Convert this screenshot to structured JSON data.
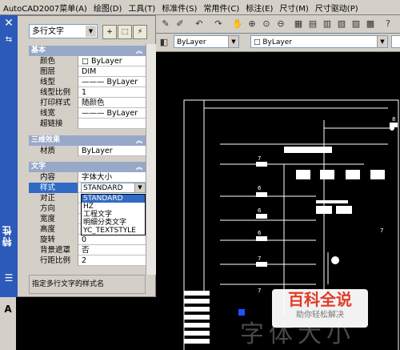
{
  "menubar": {
    "items": [
      "AutoCAD2007菜单(A)",
      "绘图(D)",
      "工具(T)",
      "标准件(S)",
      "常用件(C)",
      "标注(E)",
      "尺寸(M)",
      "尺寸驱动(P)"
    ]
  },
  "toolbar": {
    "layer_combo": "ByLayer",
    "layer_combo2": "ByLayer"
  },
  "palette": {
    "title": "特性",
    "object_type": "多行文字",
    "sections": {
      "basic": "基本",
      "3d": "三维效果",
      "text": "文字"
    },
    "basic_rows": [
      {
        "label": "颜色",
        "value": "□ ByLayer"
      },
      {
        "label": "图层",
        "value": "DIM"
      },
      {
        "label": "线型",
        "value": "——— ByLayer"
      },
      {
        "label": "线型比例",
        "value": "1"
      },
      {
        "label": "打印样式",
        "value": "随颜色"
      },
      {
        "label": "线宽",
        "value": "——— ByLayer"
      },
      {
        "label": "超链接",
        "value": ""
      }
    ],
    "3d_rows": [
      {
        "label": "材质",
        "value": "ByLayer"
      }
    ],
    "text_rows": [
      {
        "label": "内容",
        "value": "字体大小"
      },
      {
        "label": "样式",
        "value": "STANDARD"
      },
      {
        "label": "对正",
        "value": ""
      },
      {
        "label": "方向",
        "value": ""
      },
      {
        "label": "宽度",
        "value": ""
      },
      {
        "label": "高度",
        "value": ""
      },
      {
        "label": "旋转",
        "value": "0"
      },
      {
        "label": "背景遮罩",
        "value": "否"
      },
      {
        "label": "行距比例",
        "value": "2"
      }
    ],
    "description": "指定多行文字的样式名"
  },
  "style_dropdown": {
    "options": [
      "STANDARD",
      "HZ",
      "工程文字",
      "明细分类文字",
      "YC_TEXTSTYLE"
    ],
    "selected": "STANDARD"
  },
  "left_strip": {
    "a_label": "A"
  },
  "drawing": {
    "labels": [
      "7",
      "6",
      "6",
      "6",
      "7",
      "7",
      "7",
      "8"
    ],
    "bg_text": "字体大小"
  },
  "watermark": {
    "main": "百科全说",
    "sub": "助你轻松解决"
  },
  "colors": {
    "palette_strip": "#2b5ab8",
    "selection": "#316ac5",
    "canvas": "#000000"
  }
}
